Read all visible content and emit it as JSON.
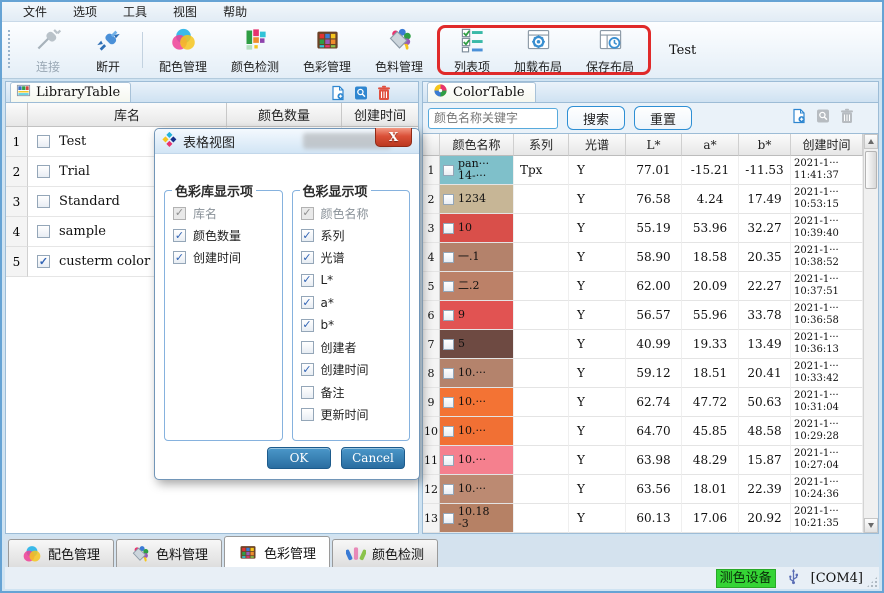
{
  "menu": {
    "items": [
      "文件",
      "选项",
      "工具",
      "视图",
      "帮助"
    ]
  },
  "toolbar": {
    "buttons": [
      {
        "label": "连接",
        "icon": "connect-icon",
        "disabled": true
      },
      {
        "label": "断开",
        "icon": "disconnect-icon",
        "disabled": false
      },
      {
        "label": "配色管理",
        "icon": "color-match-icon",
        "disabled": false
      },
      {
        "label": "颜色检测",
        "icon": "color-detect-icon",
        "disabled": false
      },
      {
        "label": "色彩管理",
        "icon": "color-manage-icon",
        "disabled": false
      },
      {
        "label": "色料管理",
        "icon": "colorant-manage-icon",
        "disabled": false
      }
    ],
    "layout_buttons": [
      {
        "label": "列表项",
        "icon": "list-items-icon"
      },
      {
        "label": "加载布局",
        "icon": "load-layout-icon"
      },
      {
        "label": "保存布局",
        "icon": "save-layout-icon"
      }
    ],
    "annotation_color": "#e02a2a",
    "profile_label": "Test"
  },
  "left_panel": {
    "title": "LibraryTable",
    "headers": [
      "库名",
      "颜色数量",
      "创建时间"
    ],
    "rows": [
      {
        "num": "1",
        "name": "Test",
        "checked": false
      },
      {
        "num": "2",
        "name": "Trial",
        "checked": false
      },
      {
        "num": "3",
        "name": "Standard",
        "checked": false
      },
      {
        "num": "4",
        "name": "sample",
        "checked": false
      },
      {
        "num": "5",
        "name": "custerm color",
        "checked": true
      }
    ]
  },
  "dialog": {
    "title": "表格视图",
    "close_label": "X",
    "groups": [
      {
        "title": "色彩库显示项",
        "items": [
          {
            "label": "库名",
            "checked": true,
            "disabled": true
          },
          {
            "label": "颜色数量",
            "checked": true,
            "disabled": false
          },
          {
            "label": "创建时间",
            "checked": true,
            "disabled": false
          }
        ]
      },
      {
        "title": "色彩显示项",
        "items": [
          {
            "label": "颜色名称",
            "checked": true,
            "disabled": true
          },
          {
            "label": "系列",
            "checked": true,
            "disabled": false
          },
          {
            "label": "光谱",
            "checked": true,
            "disabled": false
          },
          {
            "label": "L*",
            "checked": true,
            "disabled": false
          },
          {
            "label": "a*",
            "checked": true,
            "disabled": false
          },
          {
            "label": "b*",
            "checked": true,
            "disabled": false
          },
          {
            "label": "创建者",
            "checked": false,
            "disabled": false
          },
          {
            "label": "创建时间",
            "checked": true,
            "disabled": false
          },
          {
            "label": "备注",
            "checked": false,
            "disabled": false
          },
          {
            "label": "更新时间",
            "checked": false,
            "disabled": false
          }
        ]
      }
    ],
    "ok_label": "OK",
    "cancel_label": "Cancel"
  },
  "right_panel": {
    "title": "ColorTable",
    "search_placeholder": "颜色名称关键字",
    "search_label": "搜索",
    "reset_label": "重置",
    "headers": [
      "颜色名称",
      "系列",
      "光谱",
      "L*",
      "a*",
      "b*",
      "创建时间"
    ],
    "rows": [
      {
        "num": "1",
        "name_lines": [
          "pan···",
          "14-···"
        ],
        "swatch": "#7fc0ca",
        "series": "Tpx",
        "spectrum": "Y",
        "L": "77.01",
        "a": "-15.21",
        "b": "-11.53",
        "created_lines": [
          "2021-1···",
          "11:41:37"
        ]
      },
      {
        "num": "2",
        "name_lines": [
          "1234"
        ],
        "swatch": "#c7b696",
        "series": "",
        "spectrum": "Y",
        "L": "76.58",
        "a": "4.24",
        "b": "17.49",
        "created_lines": [
          "2021-1···",
          "10:53:15"
        ]
      },
      {
        "num": "3",
        "name_lines": [
          "10"
        ],
        "swatch": "#d94f4a",
        "series": "",
        "spectrum": "Y",
        "L": "55.19",
        "a": "53.96",
        "b": "32.27",
        "created_lines": [
          "2021-1···",
          "10:39:40"
        ]
      },
      {
        "num": "4",
        "name_lines": [
          "一.1"
        ],
        "swatch": "#b4826b",
        "series": "",
        "spectrum": "Y",
        "L": "58.90",
        "a": "18.58",
        "b": "20.35",
        "created_lines": [
          "2021-1···",
          "10:38:52"
        ]
      },
      {
        "num": "5",
        "name_lines": [
          "二.2"
        ],
        "swatch": "#bc8168",
        "series": "",
        "spectrum": "Y",
        "L": "62.00",
        "a": "20.09",
        "b": "22.27",
        "created_lines": [
          "2021-1···",
          "10:37:51"
        ]
      },
      {
        "num": "6",
        "name_lines": [
          "9"
        ],
        "swatch": "#e15352",
        "series": "",
        "spectrum": "Y",
        "L": "56.57",
        "a": "55.96",
        "b": "33.78",
        "created_lines": [
          "2021-1···",
          "10:36:58"
        ]
      },
      {
        "num": "7",
        "name_lines": [
          "5"
        ],
        "swatch": "#6e4a42",
        "series": "",
        "spectrum": "Y",
        "L": "40.99",
        "a": "19.33",
        "b": "13.49",
        "created_lines": [
          "2021-1···",
          "10:36:13"
        ]
      },
      {
        "num": "8",
        "name_lines": [
          "10.···"
        ],
        "swatch": "#b4836c",
        "series": "",
        "spectrum": "Y",
        "L": "59.12",
        "a": "18.51",
        "b": "20.41",
        "created_lines": [
          "2021-1···",
          "10:33:42"
        ]
      },
      {
        "num": "9",
        "name_lines": [
          "10.···"
        ],
        "swatch": "#f37334",
        "series": "",
        "spectrum": "Y",
        "L": "62.74",
        "a": "47.72",
        "b": "50.63",
        "created_lines": [
          "2021-1···",
          "10:31:04"
        ]
      },
      {
        "num": "10",
        "name_lines": [
          "10.···"
        ],
        "swatch": "#f17034",
        "series": "",
        "spectrum": "Y",
        "L": "64.70",
        "a": "45.85",
        "b": "48.58",
        "created_lines": [
          "2021-1···",
          "10:29:28"
        ]
      },
      {
        "num": "11",
        "name_lines": [
          "10.···"
        ],
        "swatch": "#f5808e",
        "series": "",
        "spectrum": "Y",
        "L": "63.98",
        "a": "48.29",
        "b": "15.87",
        "created_lines": [
          "2021-1···",
          "10:27:04"
        ]
      },
      {
        "num": "12",
        "name_lines": [
          "10.···"
        ],
        "swatch": "#bc8a72",
        "series": "",
        "spectrum": "Y",
        "L": "63.56",
        "a": "18.01",
        "b": "22.39",
        "created_lines": [
          "2021-1···",
          "10:24:36"
        ]
      },
      {
        "num": "13",
        "name_lines": [
          "10.18",
          "-3"
        ],
        "swatch": "#b68165",
        "series": "",
        "spectrum": "Y",
        "L": "60.13",
        "a": "17.06",
        "b": "20.92",
        "created_lines": [
          "2021-1···",
          "10:21:35"
        ]
      }
    ]
  },
  "bottom_tabs": [
    {
      "label": "配色管理",
      "icon": "color-match-icon",
      "active": false
    },
    {
      "label": "色料管理",
      "icon": "colorant-manage-icon",
      "active": false
    },
    {
      "label": "色彩管理",
      "icon": "color-manage-icon",
      "active": true
    },
    {
      "label": "颜色检测",
      "icon": "color-fan-icon",
      "active": false
    }
  ],
  "status_bar": {
    "device_label": "测色设备",
    "device_color": "#35d435",
    "port_label": "[COM4]"
  }
}
